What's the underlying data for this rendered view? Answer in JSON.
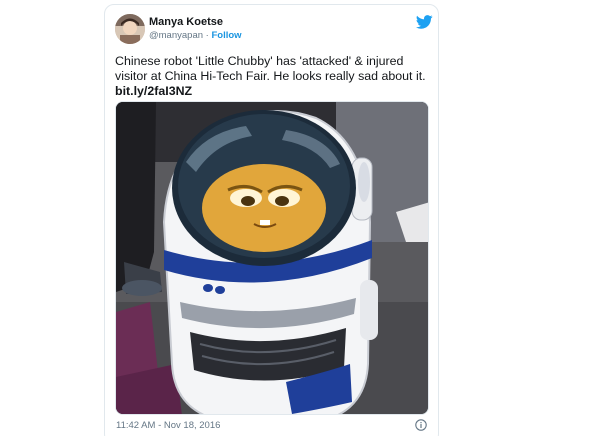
{
  "tweet": {
    "author_name": "Manya Koetse",
    "handle": "@manyapan",
    "separator": " · ",
    "follow_label": "Follow",
    "text": "Chinese robot 'Little Chubby' has 'attacked' & injured visitor at China Hi-Tech Fair. He looks really sad about it.",
    "link": "bit.ly/2faI3NZ",
    "timestamp": "11:42 AM - Nov 18, 2016"
  },
  "icons": {
    "brand": "twitter-bird-icon",
    "info": "info-icon"
  },
  "colors": {
    "twitter_blue": "#1da1f2",
    "follow_blue": "#1b95e0",
    "border": "#e1e8ed",
    "muted_text": "#657786",
    "robot_stripe": "#1f3f9a"
  }
}
